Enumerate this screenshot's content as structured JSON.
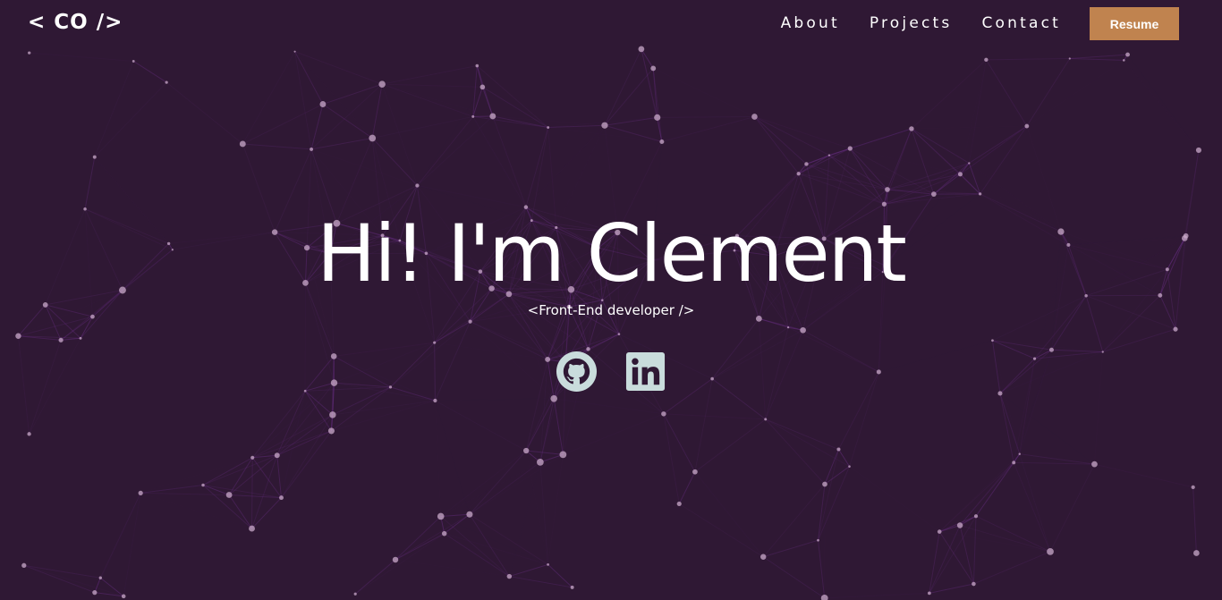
{
  "brand": {
    "logo_text": "< CO />"
  },
  "nav": {
    "links": [
      "About",
      "Projects",
      "Contact"
    ],
    "resume_label": "Resume"
  },
  "hero": {
    "title": "Hi! I'm Clement",
    "subtitle": "<Front-End developer />"
  },
  "social": {
    "icons": [
      "github-icon",
      "linkedin-icon"
    ],
    "icon_color": "#c9dcdc"
  },
  "colors": {
    "background": "#2f1834",
    "accent": "#c0834f",
    "network_line": "#6a2f86",
    "network_dot": "#c9a9c9"
  }
}
